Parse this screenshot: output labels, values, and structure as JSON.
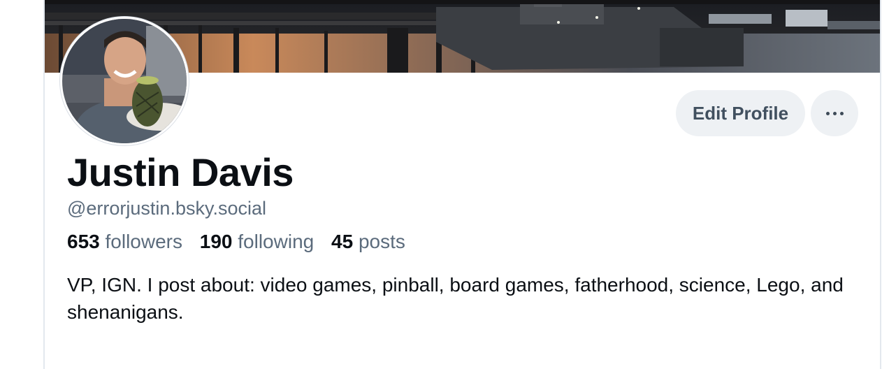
{
  "profile": {
    "display_name": "Justin Davis",
    "handle": "@errorjustin.bsky.social",
    "stats": {
      "followers_count": "653",
      "followers_label": "followers",
      "following_count": "190",
      "following_label": "following",
      "posts_count": "45",
      "posts_label": "posts"
    },
    "bio": "VP, IGN. I post about: video games, pinball, board games, fatherhood, science, Lego, and shenanigans."
  },
  "actions": {
    "edit_profile_label": "Edit Profile",
    "more_icon": "ellipsis-icon"
  },
  "colors": {
    "button_bg": "#eef1f4",
    "secondary_text": "#5b6b7c",
    "primary_text": "#0b0f14"
  }
}
